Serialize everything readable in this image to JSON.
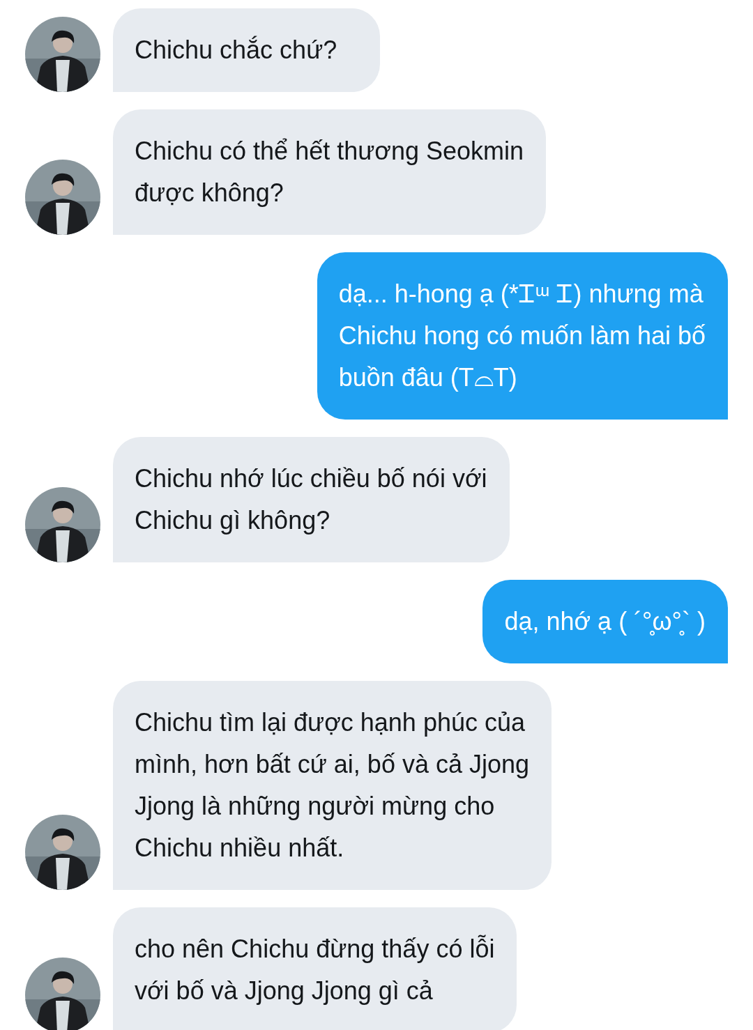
{
  "messages": [
    {
      "kind": "received",
      "text": "Chichu chắc chứ?"
    },
    {
      "kind": "received",
      "text": "Chichu có thể hết thương Seokmin\nđược không?"
    },
    {
      "kind": "sent",
      "text": "dạ... h-hong ạ (*Ꮖᵚ Ꮖ) nhưng mà\nChichu hong có muốn làm hai bố\nbuồn đâu (T⌓T)"
    },
    {
      "kind": "received",
      "text": "Chichu nhớ lúc chiều bố nói với\nChichu gì không?"
    },
    {
      "kind": "sent",
      "text": "dạ, nhớ ạ ( ´°̥ω°̥` )"
    },
    {
      "kind": "received",
      "text": "Chichu tìm lại được hạnh phúc của\nmình, hơn bất cứ ai, bố và cả Jjong\nJjong là những người mừng cho\nChichu nhiều nhất."
    },
    {
      "kind": "received",
      "text": "cho nên Chichu đừng thấy có lỗi\nvới bố và Jjong Jjong gì cả"
    }
  ]
}
